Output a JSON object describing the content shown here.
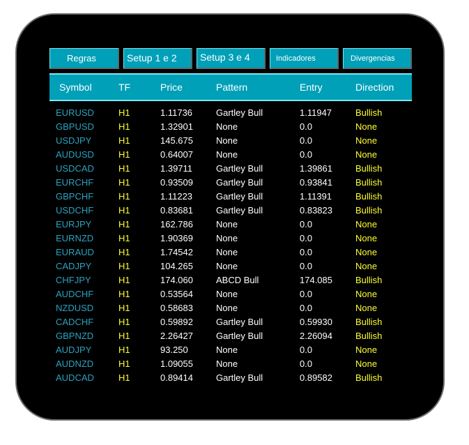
{
  "colors": {
    "background": "#000000",
    "accent": "#00a0b8",
    "symbol": "#2aa3c0",
    "timeframe": "#ffff33",
    "text": "#ffffff",
    "direction": "#ffff33"
  },
  "tabs": [
    {
      "label": "Regras"
    },
    {
      "label": "Setup 1 e 2"
    },
    {
      "label": "Setup 3 e 4"
    },
    {
      "label": "Indicadores"
    },
    {
      "label": "Divergencias"
    }
  ],
  "table": {
    "columns": [
      "Symbol",
      "TF",
      "Price",
      "Pattern",
      "Entry",
      "Direction"
    ],
    "rows": [
      [
        "EURUSD",
        "H1",
        "1.11736",
        "Gartley Bull",
        "1.11947",
        "Bullish"
      ],
      [
        "GBPUSD",
        "H1",
        "1.32901",
        "None",
        "0.0",
        "None"
      ],
      [
        "USDJPY",
        "H1",
        "145.675",
        "None",
        "0.0",
        "None"
      ],
      [
        "AUDUSD",
        "H1",
        "0.64007",
        "None",
        "0.0",
        "None"
      ],
      [
        "USDCAD",
        "H1",
        "1.39711",
        "Gartley Bull",
        "1.39861",
        "Bullish"
      ],
      [
        "EURCHF",
        "H1",
        "0.93509",
        "Gartley Bull",
        "0.93841",
        "Bullish"
      ],
      [
        "GBPCHF",
        "H1",
        "1.11223",
        "Gartley Bull",
        "1.11391",
        "Bullish"
      ],
      [
        "USDCHF",
        "H1",
        "0.83681",
        "Gartley Bull",
        "0.83823",
        "Bullish"
      ],
      [
        "EURJPY",
        "H1",
        "162.786",
        "None",
        "0.0",
        "None"
      ],
      [
        "EURNZD",
        "H1",
        "1.90369",
        "None",
        "0.0",
        "None"
      ],
      [
        "EURAUD",
        "H1",
        "1.74542",
        "None",
        "0.0",
        "None"
      ],
      [
        "CADJPY",
        "H1",
        "104.265",
        "None",
        "0.0",
        "None"
      ],
      [
        "CHFJPY",
        "H1",
        "174.060",
        "ABCD Bull",
        "174.085",
        "Bullish"
      ],
      [
        "AUDCHF",
        "H1",
        "0.53564",
        "None",
        "0.0",
        "None"
      ],
      [
        "NZDUSD",
        "H1",
        "0.58683",
        "None",
        "0.0",
        "None"
      ],
      [
        "CADCHF",
        "H1",
        "0.59892",
        "Gartley Bull",
        "0.59930",
        "Bullish"
      ],
      [
        "GBPNZD",
        "H1",
        "2.26427",
        "Gartley Bull",
        "2.26094",
        "Bullish"
      ],
      [
        "AUDJPY",
        "H1",
        "93.250",
        "None",
        "0.0",
        "None"
      ],
      [
        "AUDNZD",
        "H1",
        "1.09055",
        "None",
        "0.0",
        "None"
      ],
      [
        "AUDCAD",
        "H1",
        "0.89414",
        "Gartley Bull",
        "0.89582",
        "Bullish"
      ]
    ]
  }
}
